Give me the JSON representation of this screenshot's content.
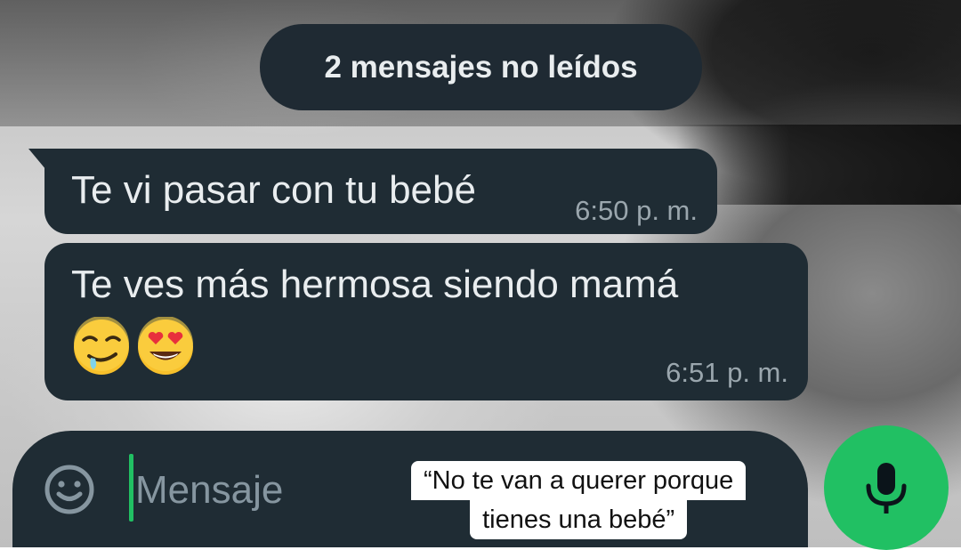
{
  "unread_banner": {
    "label": "2 mensajes no leídos"
  },
  "messages": [
    {
      "text": "Te vi pasar con tu bebé",
      "time": "6:50 p. m."
    },
    {
      "text": "Te ves más hermosa siendo mamá",
      "emojis": [
        "drooling-face",
        "smiling-face-with-heart-eyes"
      ],
      "time": "6:51 p. m."
    }
  ],
  "composer": {
    "placeholder": "Mensaje",
    "emoji_icon": "smiley-icon",
    "mic_icon": "microphone-icon"
  },
  "caption": {
    "line1": "“No te van a querer porque",
    "line2": "tienes una bebé”"
  },
  "colors": {
    "bubble": "#1f2c34",
    "accent": "#21c063",
    "text": "#e9edef",
    "meta": "#9aa6ad"
  }
}
